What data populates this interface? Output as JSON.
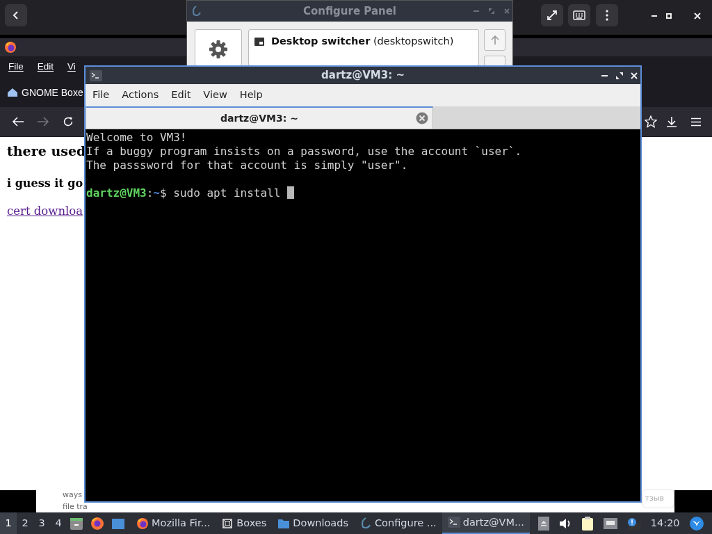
{
  "configure_panel": {
    "title": "Configure Panel",
    "plugins": [
      {
        "name": "Desktop switcher",
        "id_label": "(desktopswitch)"
      }
    ]
  },
  "firefox": {
    "menu": [
      "File",
      "Edit",
      "Vi"
    ],
    "tab": "GNOME Boxe",
    "content": [
      {
        "kind": "heading",
        "text": "there used"
      },
      {
        "kind": "subheading",
        "text": "i guess it go"
      },
      {
        "kind": "link",
        "text": "cert downloa"
      }
    ]
  },
  "background_page": {
    "texts": [
      "ways",
      "file tra"
    ],
    "button": "тзыв"
  },
  "terminal": {
    "title": "dartz@VM3: ~",
    "menu": [
      "File",
      "Actions",
      "Edit",
      "View",
      "Help"
    ],
    "tabs": [
      {
        "label": "dartz@VM3: ~",
        "selected": true
      }
    ],
    "lines": [
      "Welcome to VM3!",
      "If a buggy program insists on a password, use the account `user`.",
      "The passsword for that account is simply \"user\"."
    ],
    "prompt": [
      {
        "kind": "user",
        "text": "dartz@VM3"
      },
      {
        "kind": "plain",
        "text": ":"
      },
      {
        "kind": "path",
        "text": "~"
      },
      {
        "kind": "plain",
        "text": "$ sudo apt install "
      }
    ]
  },
  "taskbar": {
    "workspaces": [
      {
        "label": "1",
        "selected": true
      },
      {
        "label": "2",
        "selected": false
      },
      {
        "label": "3",
        "selected": false
      },
      {
        "label": "4",
        "selected": false
      }
    ],
    "tasks": [
      {
        "label": "Mozilla Fir...",
        "active": false
      },
      {
        "label": "Boxes",
        "active": false
      },
      {
        "label": "Downloads",
        "active": false
      },
      {
        "label": "Configure ...",
        "active": false
      },
      {
        "label": "dartz@VM...",
        "active": true
      }
    ],
    "clock": "14:20"
  }
}
